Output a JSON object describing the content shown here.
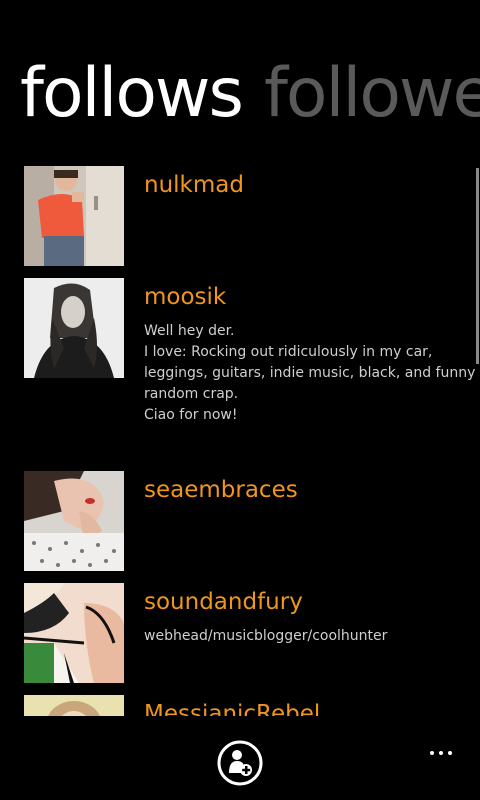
{
  "pivot": {
    "tabs": [
      {
        "label": "follows",
        "active": true
      },
      {
        "label": "followers",
        "active": false
      }
    ]
  },
  "users": [
    {
      "name": "nulkmad",
      "bio": []
    },
    {
      "name": "moosik",
      "bio": [
        "Well hey der.",
        "I love: Rocking out ridiculously in my car,",
        "leggings, guitars, indie music, black, and funny",
        "random crap.",
        "Ciao for now!"
      ]
    },
    {
      "name": "seaembraces",
      "bio": []
    },
    {
      "name": "soundandfury",
      "bio": [
        "webhead/musicblogger/coolhunter"
      ]
    },
    {
      "name": "MessianicRebel",
      "bio": []
    }
  ],
  "appbar": {
    "primary_icon": "add-friend-icon",
    "more_icon": "ellipsis-icon"
  },
  "colors": {
    "accent": "#f0961e",
    "background": "#000000",
    "inactive_tab": "#5a5a5a"
  }
}
